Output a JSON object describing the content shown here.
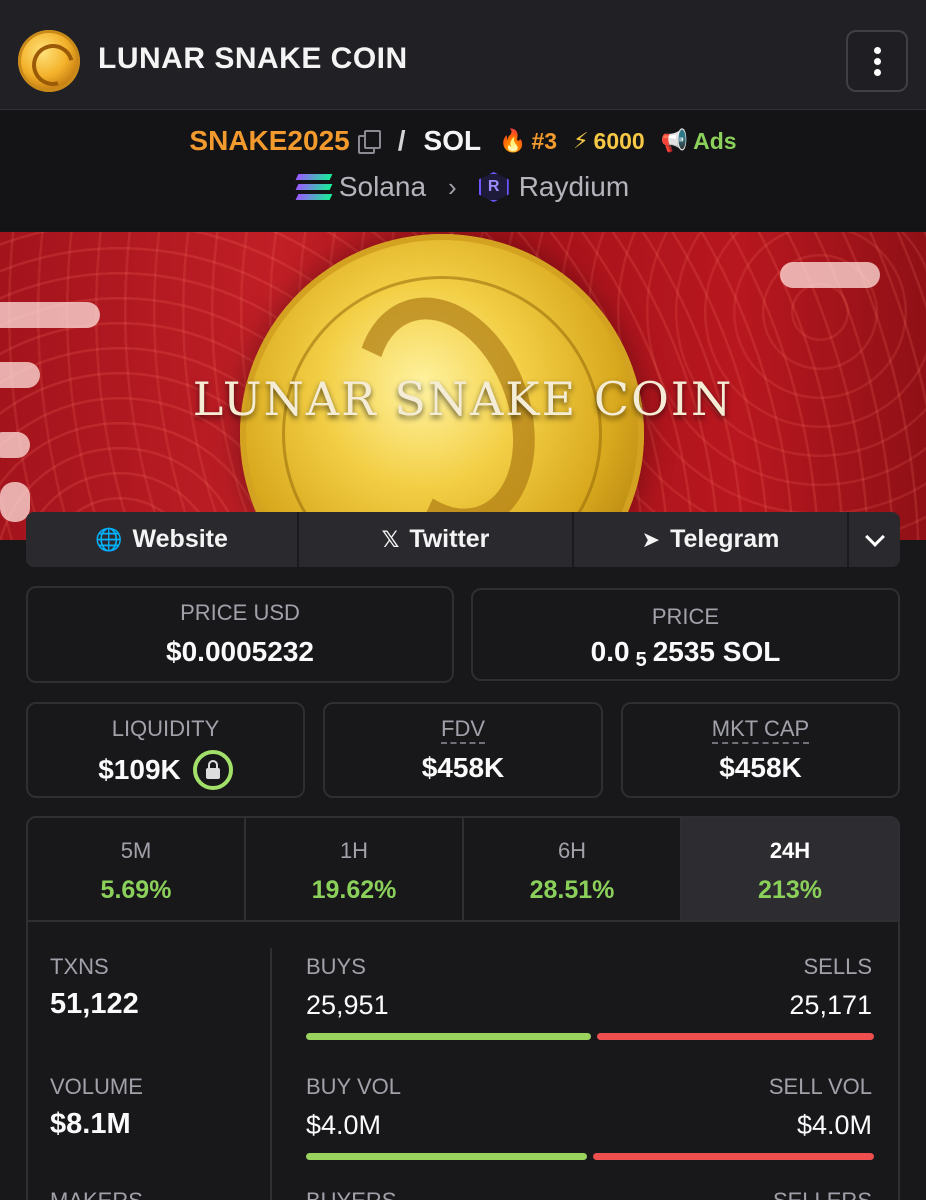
{
  "header": {
    "title": "LUNAR SNAKE COIN",
    "logo_icon": "coin-logo",
    "menu_icon": "vertical-dots-icon"
  },
  "pair": {
    "base": "SNAKE2025",
    "slash": "/",
    "quote": "SOL",
    "rank": "#3",
    "boost": "6000",
    "ads": "Ads",
    "chain": "Solana",
    "dex": "Raydium"
  },
  "banner": {
    "title": "LUNAR SNAKE COIN"
  },
  "links": {
    "website": "Website",
    "twitter": "Twitter",
    "telegram": "Telegram"
  },
  "stats": {
    "price_usd_label": "PRICE USD",
    "price_usd": "$0.0005232",
    "price_label": "PRICE",
    "price_prefix": "0.0",
    "price_sub": "5",
    "price_rest": "2535 SOL",
    "liquidity_label": "LIQUIDITY",
    "liquidity": "$109K",
    "fdv_label": "FDV",
    "fdv": "$458K",
    "mktcap_label": "MKT CAP",
    "mktcap": "$458K"
  },
  "timeframes": [
    {
      "label": "5M",
      "value": "5.69%"
    },
    {
      "label": "1H",
      "value": "19.62%"
    },
    {
      "label": "6H",
      "value": "28.51%"
    },
    {
      "label": "24H",
      "value": "213%",
      "active": true
    }
  ],
  "txns": {
    "txns_label": "TXNS",
    "txns": "51,122",
    "buys_label": "BUYS",
    "buys": "25,951",
    "sells_label": "SELLS",
    "sells": "25,171",
    "volume_label": "VOLUME",
    "volume": "$8.1M",
    "buy_vol_label": "BUY VOL",
    "buy_vol": "$4.0M",
    "sell_vol_label": "SELL VOL",
    "sell_vol": "$4.0M",
    "buys_share": 0.508,
    "buy_vol_share": 0.5,
    "makers_label": "MAKERS",
    "buyers_label": "BUYERS",
    "sellers_label": "SELLERS"
  },
  "colors": {
    "green": "#8bd05a",
    "red": "#ef4f4f",
    "orange": "#f29a2e",
    "background": "#18181b"
  }
}
